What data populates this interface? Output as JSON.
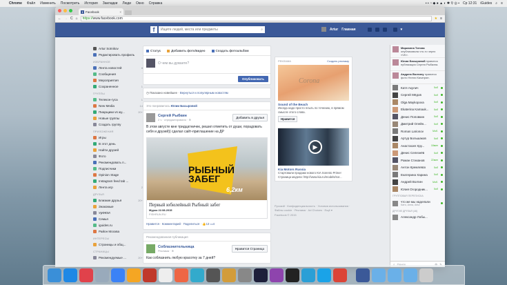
{
  "menubar": {
    "app": "Chrome",
    "items": [
      "Файл",
      "Изменить",
      "Посмотреть",
      "История",
      "Закладки",
      "Люди",
      "Окно",
      "Справка"
    ],
    "clock": "Ср 12:31",
    "user": "iGuides"
  },
  "browser": {
    "tab_title": "Facebook",
    "url_scheme": "https://",
    "url_host": "www.facebook.com"
  },
  "header": {
    "logo": "f",
    "search_placeholder": "Ищите людей, места или предметы",
    "user": "Artur",
    "home": "Главная"
  },
  "leftnav": {
    "profile": [
      {
        "label": "Artur Sotnikov"
      },
      {
        "label": "Редактировать профиль"
      }
    ],
    "sections": [
      {
        "title": "ИЗБРАННОЕ",
        "items": [
          {
            "label": "Лента новостей",
            "count": "▾"
          },
          {
            "label": "Сообщения",
            "count": ""
          },
          {
            "label": "Мероприятия",
            "count": ""
          },
          {
            "label": "Сохраненное",
            "count": "1"
          }
        ]
      },
      {
        "title": "ГРУППЫ",
        "items": [
          {
            "label": "Телекон-гуса",
            "count": "1"
          },
          {
            "label": "New Media",
            "count": "14"
          },
          {
            "label": "Пиарщики vs жу...",
            "count": "20+"
          },
          {
            "label": "Новые группы",
            "count": ""
          },
          {
            "label": "Создать группу",
            "count": ""
          }
        ]
      },
      {
        "title": "ПРИЛОЖЕНИЯ",
        "items": [
          {
            "label": "Игры",
            "count": ""
          },
          {
            "label": "В этот день",
            "count": ""
          },
          {
            "label": "Найти друзей",
            "count": ""
          },
          {
            "label": "Фото",
            "count": ""
          },
          {
            "label": "Рекомендовать п...",
            "count": ""
          },
          {
            "label": "Подписчики",
            "count": ""
          },
          {
            "label": "Opinion Stage",
            "count": ""
          },
          {
            "label": "Instagram feed tab ...",
            "count": ""
          },
          {
            "label": "Лента игр",
            "count": "2"
          }
        ]
      },
      {
        "title": "ДРУЗЬЯ",
        "items": [
          {
            "label": "Близкие друзья",
            "count": "20+"
          },
          {
            "label": "Знакомые",
            "count": ""
          },
          {
            "label": "УрФЮИ",
            "count": ""
          },
          {
            "label": "Семья",
            "count": ""
          },
          {
            "label": "iguides.ru",
            "count": ""
          },
          {
            "label": "Район Москва",
            "count": ""
          }
        ]
      },
      {
        "title": "ИНТЕРЕСЫ",
        "items": [
          {
            "label": "Страницы и общ...",
            "count": ""
          }
        ]
      },
      {
        "title": "СТРАНИЦЫ",
        "items": [
          {
            "label": "Рекомендуемые ...",
            "count": "20+"
          }
        ]
      }
    ]
  },
  "composer": {
    "tabs": [
      "Статус",
      "Добавить фото/видео",
      "Создать фотоальбом"
    ],
    "placeholder": "О чем вы думаете?",
    "publish": "Опубликовать"
  },
  "notice": {
    "text": "Показано новейшее · ",
    "link": "Вернуться к популярным новостям"
  },
  "post": {
    "liked_by_prefix": "Это понравилось ",
    "liked_by": "Юлии Басыровой",
    "author": "Сергей Рыбкин",
    "meta": "2 ч · отредактировано · ⊕",
    "add_friend": "Добавить в друзья",
    "text": "В этом августе мне тридцатничек, решил отметить от души, порадовать себя и друзей)) сделал сайт-приглашение на ДР",
    "image_line1": "РЫБНЫЙ",
    "image_line2": "ЗАБЕГ",
    "image_km": "6,2км",
    "link_title": "Первый юбилейный Рыбный забег",
    "link_sub": "Мурок 22.08.2015",
    "link_domain": "FISHRUN.RU",
    "actions": "Нравится · Комментарий · Поделиться · ",
    "likes": "13",
    "comments": "4"
  },
  "post2": {
    "header": "Рекомендованная публикация",
    "author": "Соблазнительница",
    "meta": "Реклама · ⊕",
    "like_page": "Нравится Страница",
    "text": "Как соблазнить любую красотку за 7 дней?"
  },
  "ads": {
    "title": "РЕКЛАМА",
    "create": "Создать рекламу",
    "items": [
      {
        "img_text": "Corona",
        "title": "Sound of the Beach",
        "desc": "Иногда надо просто плыть по течению, в прямом смысле этого слова.",
        "button": "Нравится"
      },
      {
        "title": "Kia Motors Russia",
        "desc": "Стартовали продажи нового KIA Sorento Prime! Страница модели: http://www.kia.ru/models/sor..."
      }
    ]
  },
  "footer": {
    "links": "Русский · Конфиденциальность · Условия использования · Файлы cookie · Реклама · Ad Choices · Ещё ▾",
    "copyright": "Facebook © 2015"
  },
  "chat": {
    "ticker": [
      {
        "name": "Марианна Титова",
        "text": "опубликовала что-то через «VK»."
      },
      {
        "name": "Юлии Басыровой",
        "text": "нравится публикация Сергея Рыбкина."
      },
      {
        "name": "Андрею Волгину",
        "text": "нравится фото Нелли Качатрян."
      }
    ],
    "friends": [
      {
        "name": "Катя Акулич",
        "status": "5об"
      },
      {
        "name": "Сергей Мёдов",
        "status": "5об"
      },
      {
        "name": "Olga Maykopova",
        "status": "5об"
      },
      {
        "name": "Ekaterina Kamauk...",
        "status": "5об"
      },
      {
        "name": "Денис Поповкин",
        "status": "5об"
      },
      {
        "name": "Дмитрий Олейн...",
        "status": "5об"
      },
      {
        "name": "Roman Larionov",
        "status": "Моб."
      },
      {
        "name": "Артур Большаков",
        "status": "5об"
      },
      {
        "name": "Анастасия Хру...",
        "status": "18мин"
      },
      {
        "name": "Денис Селезнёв",
        "status": "5об"
      },
      {
        "name": "Роман Стиханов",
        "status": "22мин"
      },
      {
        "name": "Антон Кремлевск",
        "status": "5об"
      },
      {
        "name": "Екатерина Харина",
        "status": "5об"
      },
      {
        "name": "Андрей Волгин",
        "status": "Моб."
      },
      {
        "name": "Юлия Огородник...",
        "status": "5об"
      }
    ],
    "group_section": "ГРУППОВАЯ ПЕРЕПИСКА",
    "group": {
      "name": "что же мы наделали",
      "members": "Катя, Анна, Artur"
    },
    "other_section": "ДРУГИЕ ДРУЗЬЯ (46)",
    "other_first": "Александр Лобы...",
    "search": "Поиск"
  },
  "dock_colors": [
    "#3a8fd8",
    "#1e88e5",
    "#e0424b",
    "#9ab",
    "#3b82f6",
    "#f5a623",
    "#c0392b",
    "#eee",
    "#e64",
    "#3ac",
    "#555",
    "#d29c3a",
    "#888",
    "#1d1f3a",
    "#8e44ad",
    "#222",
    "#2a9fd6",
    "#1aa3e8",
    "#db4437",
    "#3b5998",
    "#6ab0e8",
    "#6ab0e8",
    "#6ab0e8",
    "#ccc"
  ]
}
